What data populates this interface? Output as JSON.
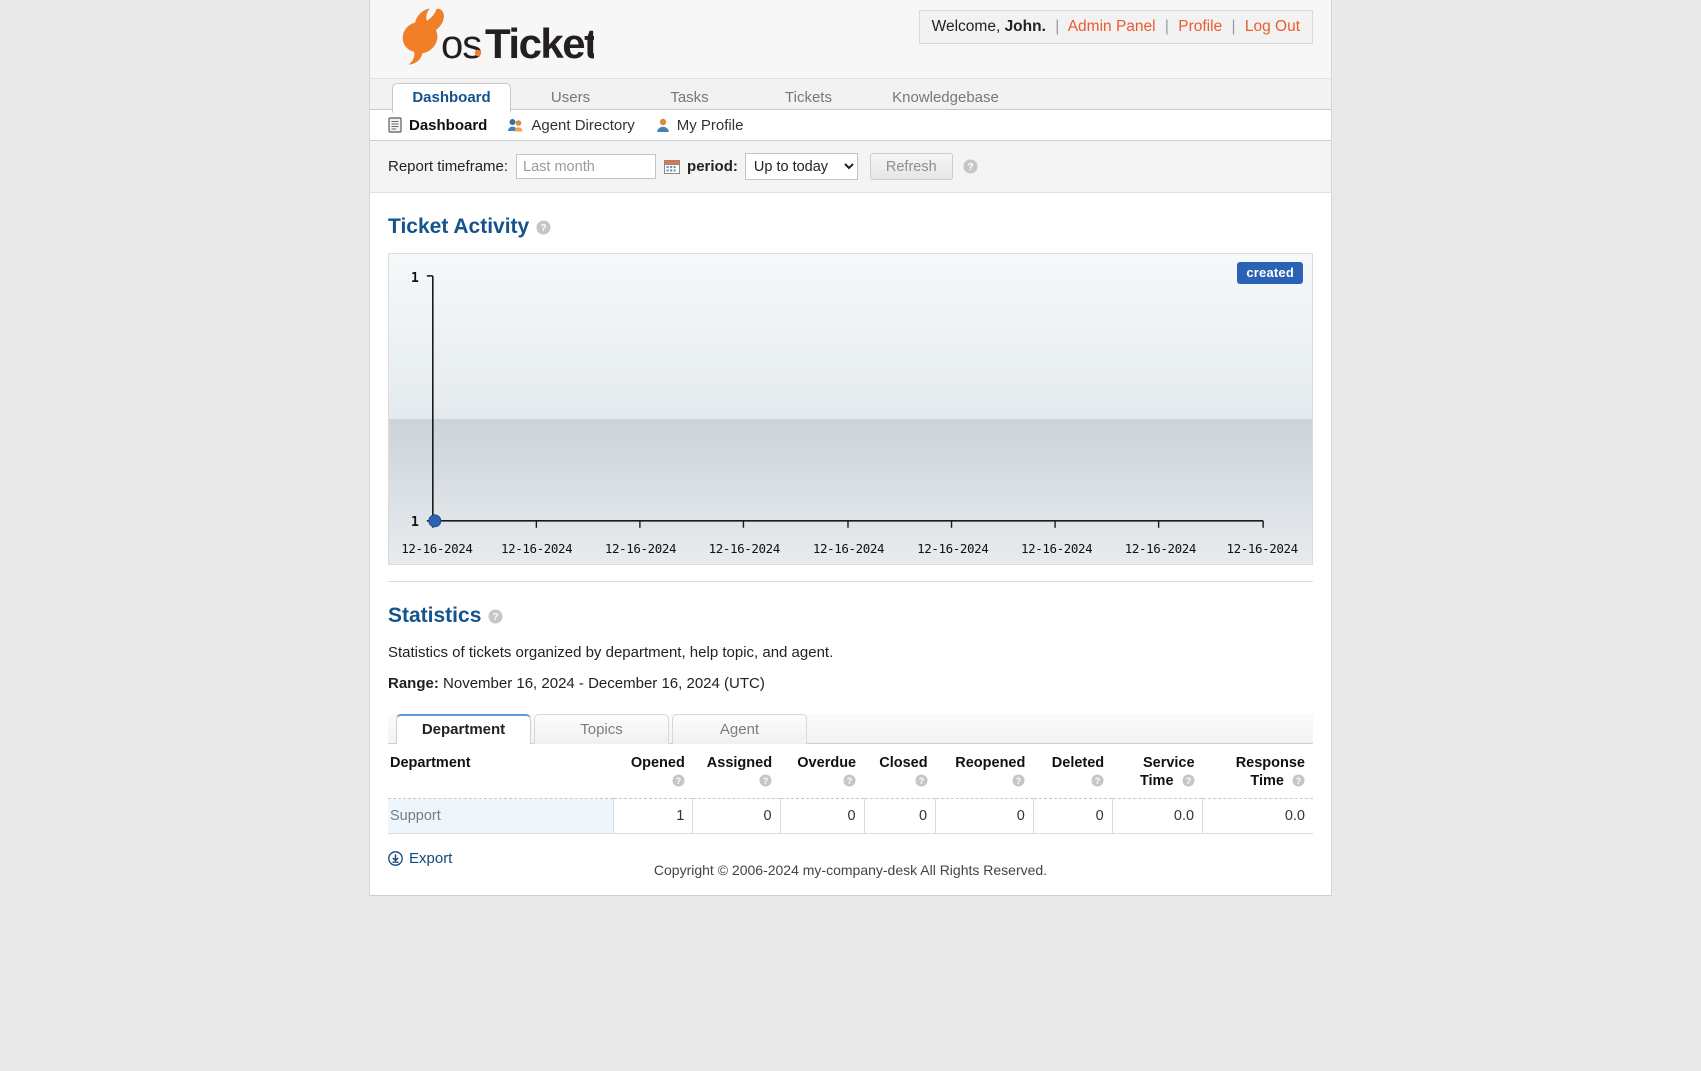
{
  "brand": {
    "name": "osTicket",
    "logo_os": "os",
    "logo_ticket": "Ticket",
    "accent": "#f07f27"
  },
  "header": {
    "welcome_prefix": "Welcome,",
    "user": "John.",
    "sep": "|",
    "links": [
      {
        "label": "Admin Panel",
        "name": "admin-panel-link"
      },
      {
        "label": "Profile",
        "name": "profile-link"
      },
      {
        "label": "Log Out",
        "name": "logout-link"
      }
    ],
    "link_color": "#eb5b30"
  },
  "nav": {
    "tabs": [
      {
        "label": "Dashboard",
        "active": true
      },
      {
        "label": "Users",
        "active": false
      },
      {
        "label": "Tasks",
        "active": false
      },
      {
        "label": "Tickets",
        "active": false
      },
      {
        "label": "Knowledgebase",
        "active": false
      }
    ],
    "subnav": [
      {
        "label": "Dashboard",
        "icon": "document-icon",
        "current": true
      },
      {
        "label": "Agent Directory",
        "icon": "users-group-icon",
        "current": false
      },
      {
        "label": "My Profile",
        "icon": "user-icon",
        "current": false
      }
    ]
  },
  "toolbar": {
    "timeframe_label": "Report timeframe:",
    "timeframe_value": "",
    "timeframe_placeholder": "Last month",
    "calendar_icon": "calendar-icon",
    "period_label": "period:",
    "period_value": "Up to today",
    "period_options": [
      "Up to today"
    ],
    "refresh_label": "Refresh",
    "help_icon": "help-icon"
  },
  "activity": {
    "title": "Ticket Activity",
    "help_icon": "help-icon"
  },
  "chart_data": {
    "type": "line",
    "title": "Ticket Activity",
    "legend": [
      "created"
    ],
    "legend_position": "top-right",
    "legend_color": "#2c62b5",
    "series": [
      {
        "name": "created",
        "values": [
          1,
          null,
          null,
          null,
          null,
          null,
          null,
          null,
          null
        ]
      }
    ],
    "x": [
      "12-16-2024",
      "12-16-2024",
      "12-16-2024",
      "12-16-2024",
      "12-16-2024",
      "12-16-2024",
      "12-16-2024",
      "12-16-2024",
      "12-16-2024"
    ],
    "xlabel": "",
    "ylabel": "",
    "ytick_labels": [
      "1",
      "1"
    ],
    "ylim": [
      1,
      1
    ],
    "grid": false,
    "point_color": "#2c62b5",
    "marked_points": [
      {
        "x_index": 0,
        "y": 1
      }
    ]
  },
  "statistics": {
    "title": "Statistics",
    "help_icon": "help-icon",
    "description": "Statistics of tickets organized by department, help topic, and agent.",
    "range_label": "Range:",
    "range_value": "November 16, 2024 - December 16, 2024 (UTC)",
    "tabs": [
      {
        "label": "Department",
        "active": true
      },
      {
        "label": "Topics",
        "active": false
      },
      {
        "label": "Agent",
        "active": false
      }
    ],
    "columns": [
      {
        "label": "Department",
        "help": false
      },
      {
        "label": "Opened",
        "help": true
      },
      {
        "label": "Assigned",
        "help": true
      },
      {
        "label": "Overdue",
        "help": true
      },
      {
        "label": "Closed",
        "help": true
      },
      {
        "label": "Reopened",
        "help": true
      },
      {
        "label": "Deleted",
        "help": true
      },
      {
        "label": "Service Time",
        "help": true
      },
      {
        "label": "Response Time",
        "help": true
      }
    ],
    "rows": [
      {
        "name": "Support",
        "values": [
          "1",
          "0",
          "0",
          "0",
          "0",
          "0",
          "0.0",
          "0.0"
        ]
      }
    ],
    "export_label": "Export",
    "export_icon": "download-circle-icon"
  },
  "footer": {
    "copyright": "Copyright © 2006-2024 my-company-desk All Rights Reserved."
  }
}
